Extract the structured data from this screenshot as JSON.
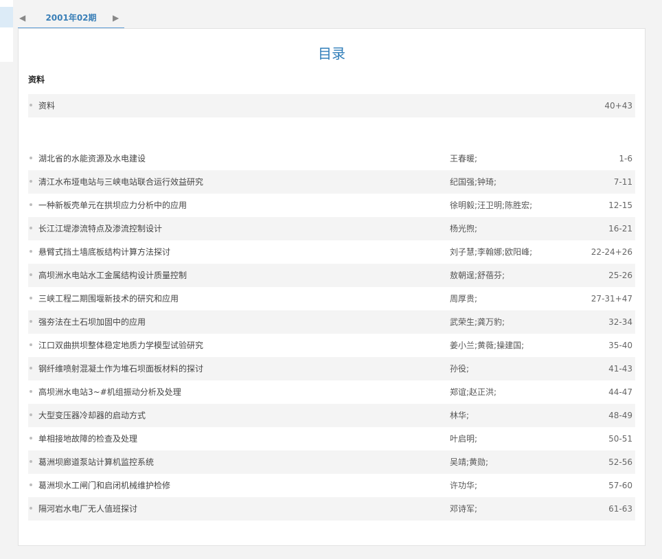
{
  "issue_nav": {
    "current_issue": "2001年02期",
    "prev_icon": "◀",
    "next_icon": "▶"
  },
  "toc": {
    "title": "目录",
    "section_heading": "资料",
    "section_items": [
      {
        "title": "资料",
        "authors": "",
        "pages": "40+43"
      }
    ],
    "articles": [
      {
        "title": "湖北省的水能资源及水电建设",
        "authors": "王春暖;",
        "pages": "1-6"
      },
      {
        "title": "清江水布垭电站与三峡电站联合运行效益研究",
        "authors": "纪国强;钟琦;",
        "pages": "7-11"
      },
      {
        "title": "一种新板壳单元在拱坝应力分析中的应用",
        "authors": "徐明毅;汪卫明;陈胜宏;",
        "pages": "12-15"
      },
      {
        "title": "长江江堤渗流特点及渗流控制设计",
        "authors": "杨光煦;",
        "pages": "16-21"
      },
      {
        "title": "悬臂式挡土墙底板结构计算方法探讨",
        "authors": "刘子慧;李翰娜;欧阳峰;",
        "pages": "22-24+26"
      },
      {
        "title": "高坝洲水电站水工金属结构设计质量控制",
        "authors": "敖朝逞;舒蓓芬;",
        "pages": "25-26"
      },
      {
        "title": "三峡工程二期围堰新技术的研究和应用",
        "authors": "周厚贵;",
        "pages": "27-31+47"
      },
      {
        "title": "强夯法在土石坝加固中的应用",
        "authors": "武荣生;龚万豹;",
        "pages": "32-34"
      },
      {
        "title": "江口双曲拱坝整体稳定地质力学模型试验研究",
        "authors": "姜小兰;黄薇;操建国;",
        "pages": "35-40"
      },
      {
        "title": "钢纤维喷射混凝土作为堆石坝面板材料的探讨",
        "authors": "孙役;",
        "pages": "41-43"
      },
      {
        "title": "高坝洲水电站3~#机组振动分析及处理",
        "authors": "郑谊;赵正洪;",
        "pages": "44-47"
      },
      {
        "title": "大型变压器冷却器的启动方式",
        "authors": "林华;",
        "pages": "48-49"
      },
      {
        "title": "单相接地故障的检查及处理",
        "authors": "叶启明;",
        "pages": "50-51"
      },
      {
        "title": "葛洲坝廊道泵站计算机监控系统",
        "authors": "吴靖;黄勋;",
        "pages": "52-56"
      },
      {
        "title": "葛洲坝水工闸门和启闭机械维护检修",
        "authors": "许功华;",
        "pages": "57-60"
      },
      {
        "title": "隔河岩水电厂无人值班探讨",
        "authors": "邓诗军;",
        "pages": "61-63"
      }
    ]
  }
}
